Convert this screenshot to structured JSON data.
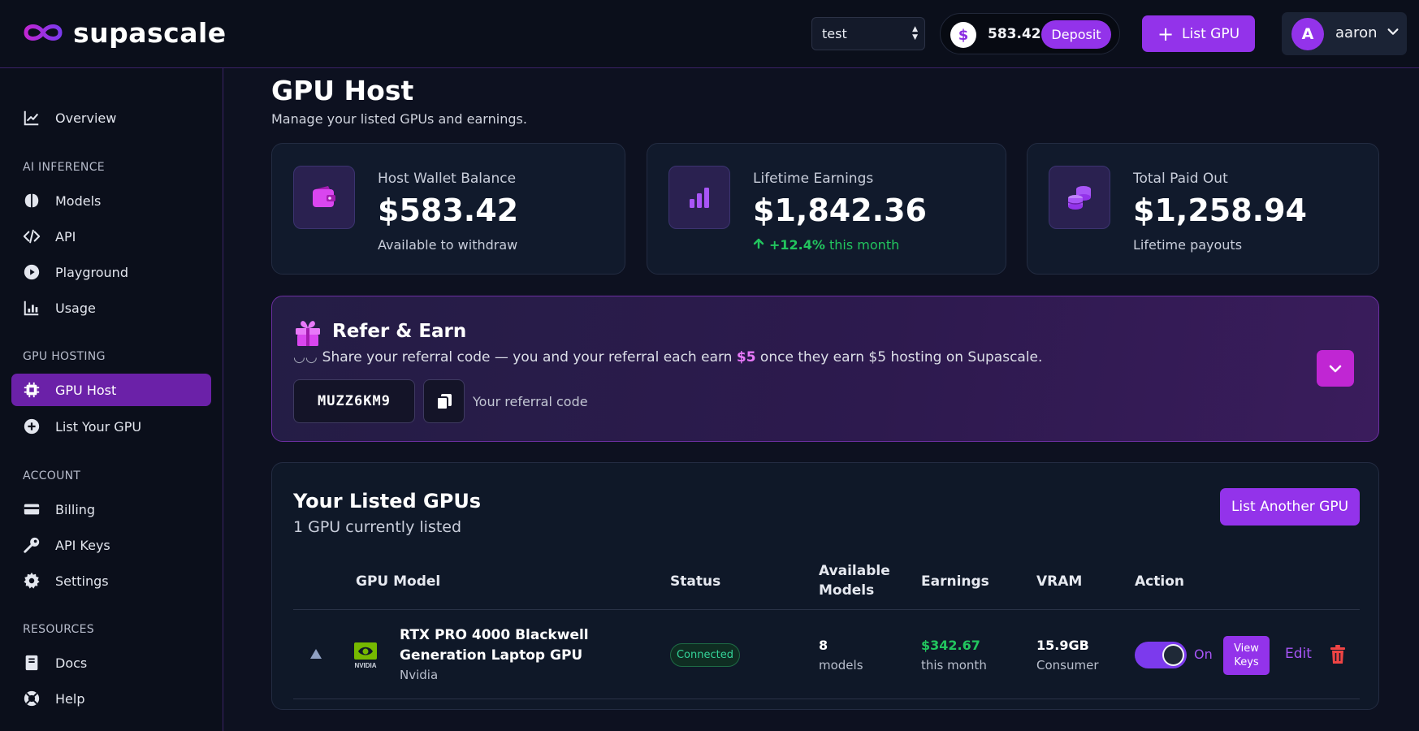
{
  "app": {
    "brand": "supascale"
  },
  "topbar": {
    "team_select": "test",
    "wallet_symbol": "$",
    "wallet_amount": "583.42",
    "deposit_label": "Deposit",
    "list_gpu_label": "List GPU",
    "user_initial": "A",
    "user_name": "aaron"
  },
  "sidebar": {
    "overview": "Overview",
    "section_ai": "AI INFERENCE",
    "models": "Models",
    "api": "API",
    "playground": "Playground",
    "usage": "Usage",
    "section_gpu": "GPU HOSTING",
    "gpu_host": "GPU Host",
    "list_your_gpu": "List Your GPU",
    "section_account": "ACCOUNT",
    "billing": "Billing",
    "api_keys": "API Keys",
    "settings": "Settings",
    "section_resources": "RESOURCES",
    "docs": "Docs",
    "help": "Help"
  },
  "page": {
    "title": "GPU Host",
    "subtitle": "Manage your listed GPUs and earnings."
  },
  "stats": {
    "wallet": {
      "label": "Host Wallet Balance",
      "value": "$583.42",
      "foot": "Available to withdraw",
      "icon": "wallet-icon"
    },
    "earnings": {
      "label": "Lifetime Earnings",
      "value": "$1,842.36",
      "change": "+12.4%",
      "foot": "this month",
      "icon": "bar-chart-icon"
    },
    "payout": {
      "label": "Total Paid Out",
      "value": "$1,258.94",
      "foot": "Lifetime payouts",
      "icon": "coins-icon"
    }
  },
  "refer": {
    "title": "Refer & Earn",
    "desc_decor": "◡◡",
    "desc_before": "Share your referral code — you and your referral each earn ",
    "desc_amount": "$5",
    "desc_after": " once they earn $5 hosting on Supascale.",
    "code": "MUZZ6KM9",
    "code_label": "Your referral code"
  },
  "gpus": {
    "title": "Your Listed GPUs",
    "subtitle": "1 GPU currently listed",
    "list_another_label": "List Another GPU",
    "headers": {
      "model": "GPU Model",
      "status": "Status",
      "available_1": "Available",
      "available_2": "Models",
      "earnings": "Earnings",
      "vram": "VRAM",
      "action": "Action"
    },
    "rows": [
      {
        "name": "RTX PRO 4000 Blackwell Generation Laptop GPU",
        "vendor": "Nvidia",
        "vendor_logo_text": "NVIDIA",
        "status": "Connected",
        "models_count": "8",
        "models_unit": "models",
        "earnings": "$342.67",
        "earnings_period": "this month",
        "vram": "15.9GB",
        "vram_type": "Consumer",
        "toggle_label": "On",
        "view_keys_1": "View",
        "view_keys_2": "Keys",
        "edit_label": "Edit"
      }
    ]
  },
  "colors": {
    "accent": "#9333ea",
    "success": "#22c55e",
    "danger": "#ef4444",
    "background": "#0d1120"
  }
}
